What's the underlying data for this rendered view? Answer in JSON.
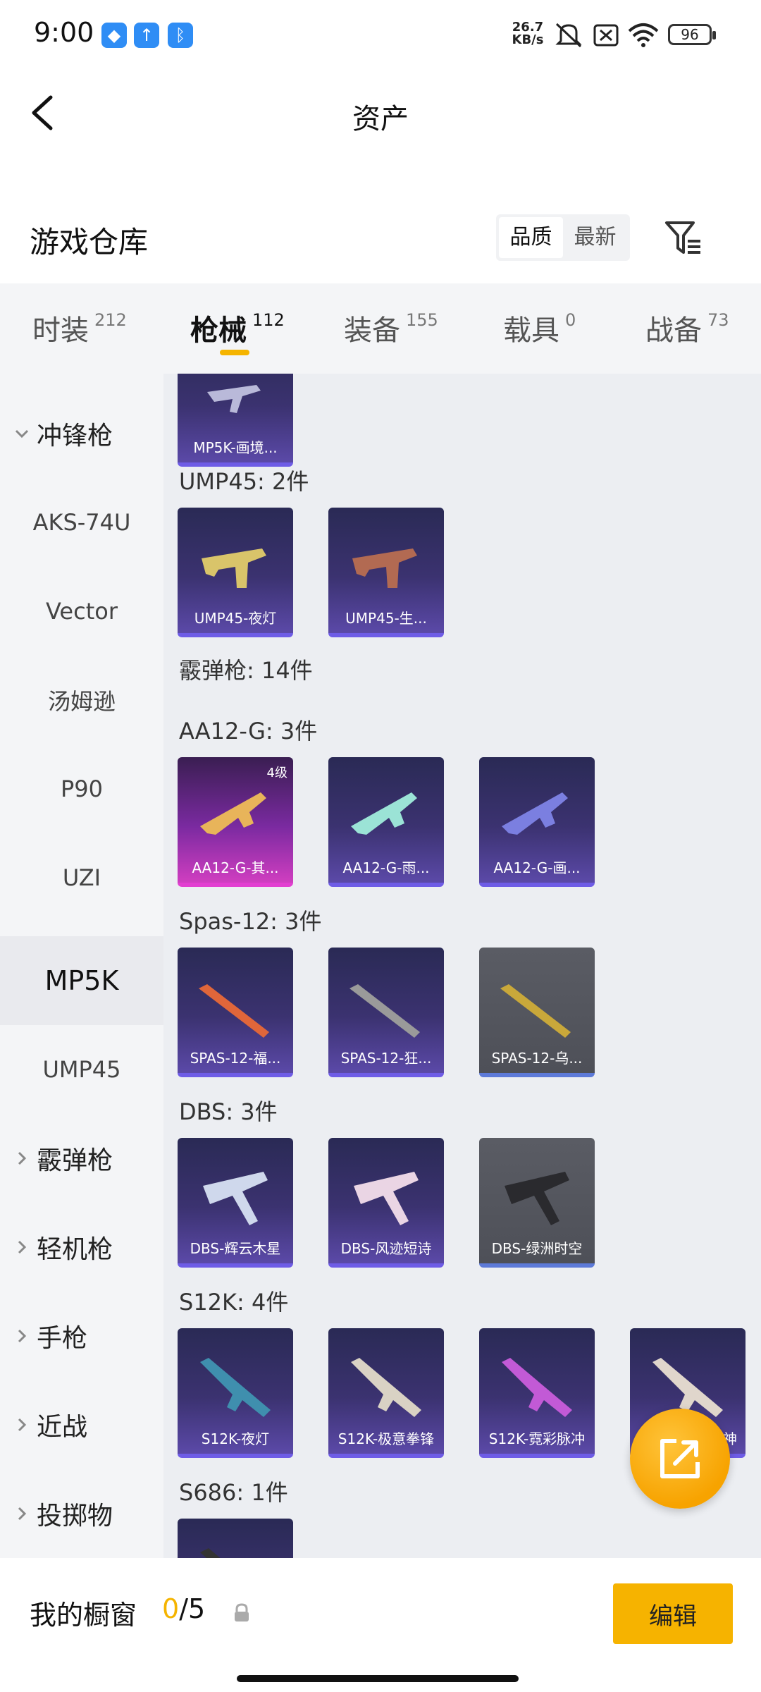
{
  "status_bar": {
    "time": "9:00",
    "net_speed": "26.7",
    "net_unit": "KB/s",
    "battery": "96",
    "icons": [
      "app-icon",
      "upload-icon",
      "bluetooth-icon",
      "mute-icon",
      "sim-off-icon",
      "wifi-icon",
      "battery-icon"
    ]
  },
  "nav": {
    "title": "资产"
  },
  "section": {
    "title": "游戏仓库",
    "sort_quality": "品质",
    "sort_latest": "最新"
  },
  "category_tabs": [
    {
      "label": "时装",
      "count": "212"
    },
    {
      "label": "枪械",
      "count": "112"
    },
    {
      "label": "装备",
      "count": "155"
    },
    {
      "label": "载具",
      "count": "0"
    },
    {
      "label": "战备",
      "count": "73"
    }
  ],
  "sidebar": {
    "group_smg": "冲锋枪",
    "items": [
      "AKS-74U",
      "Vector",
      "汤姆逊",
      "P90",
      "UZI",
      "MP5K",
      "UMP45"
    ],
    "groups": [
      "霰弹枪",
      "轻机枪",
      "手枪",
      "近战",
      "投掷物"
    ]
  },
  "content": {
    "top_card": "MP5K-画境...",
    "groups": [
      {
        "label": "UMP45: 2件",
        "cards": [
          "UMP45-夜灯",
          "UMP45-生..."
        ]
      },
      {
        "label": "霰弹枪: 14件",
        "cards": []
      },
      {
        "label": "AA12-G: 3件",
        "cards": [
          "AA12-G-其...",
          "AA12-G-雨...",
          "AA12-G-画..."
        ],
        "first_level": "4级"
      },
      {
        "label": "Spas-12: 3件",
        "cards": [
          "SPAS-12-福...",
          "SPAS-12-狂...",
          "SPAS-12-乌..."
        ]
      },
      {
        "label": "DBS: 3件",
        "cards": [
          "DBS-辉云木星",
          "DBS-风迹短诗",
          "DBS-绿洲时空"
        ]
      },
      {
        "label": "S12K: 4件",
        "cards": [
          "S12K-夜灯",
          "S12K-极意拳锋",
          "S12K-霓彩脉冲",
          "神"
        ]
      },
      {
        "label": "S686: 1件",
        "cards": [
          ""
        ]
      }
    ]
  },
  "bottom": {
    "label": "我的橱窗",
    "current": "0",
    "total": "/5",
    "edit": "编辑"
  },
  "colors": {
    "accent": "#f5b400",
    "rarity_purple": "#6e5ce6",
    "rarity_gold": "#e23fd1"
  }
}
